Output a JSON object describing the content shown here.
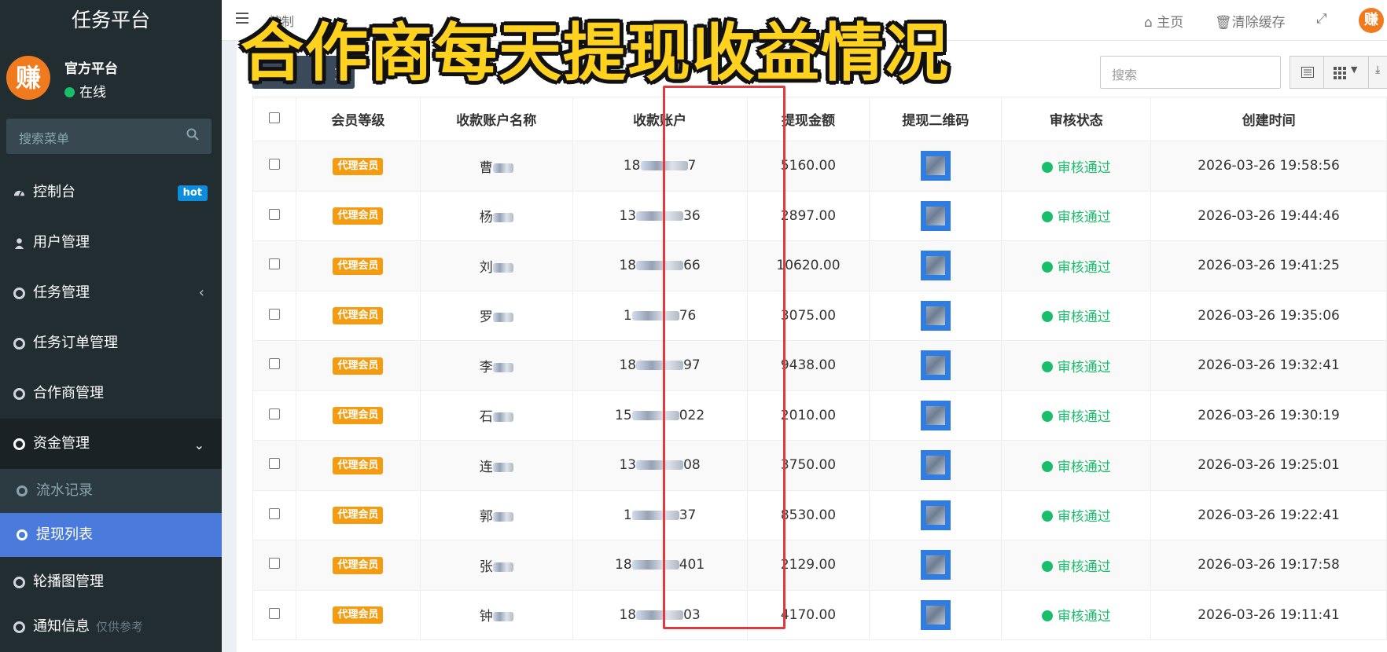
{
  "overlay": {
    "title": "合作商每天提现收益情况"
  },
  "sidebar": {
    "brand": "任务平台",
    "avatar_text": "赚",
    "user_name": "官方平台",
    "user_status": "在线",
    "search_placeholder": "搜索菜单",
    "items": [
      {
        "label": "控制台",
        "badge": "hot"
      },
      {
        "label": "用户管理"
      },
      {
        "label": "任务管理"
      },
      {
        "label": "任务订单管理"
      },
      {
        "label": "合作商管理"
      },
      {
        "label": "资金管理"
      },
      {
        "label": "轮播图管理"
      },
      {
        "label": "通知信息",
        "hint": "仅供参考"
      }
    ],
    "submenu": [
      {
        "label": "流水记录"
      },
      {
        "label": "提现列表"
      }
    ]
  },
  "topbar": {
    "tab": "控制",
    "home": "主页",
    "clear_cache": "清除缓存",
    "avatar_text": "赚"
  },
  "toolbar": {
    "button_partial": "更",
    "search_placeholder": "搜索"
  },
  "table": {
    "headers": [
      "会员等级",
      "收款账户名称",
      "收款账户",
      "提现金额",
      "提现二维码",
      "审核状态",
      "创建时间"
    ],
    "rows": [
      {
        "level": "代理会员",
        "name": "曹",
        "name_tail": "q",
        "account_head": "18",
        "account_tail": "7",
        "amount": "5160.00",
        "status": "审核通过",
        "time": "2026-03-26 19:58:56"
      },
      {
        "level": "代理会员",
        "name": "杨",
        "name_tail": "",
        "account_head": "13",
        "account_tail": "36",
        "amount": "2897.00",
        "status": "审核通过",
        "time": "2026-03-26 19:44:46"
      },
      {
        "level": "代理会员",
        "name": "刘",
        "name_tail": "",
        "account_head": "18",
        "account_tail": "66",
        "amount": "10620.00",
        "status": "审核通过",
        "time": "2026-03-26 19:41:25"
      },
      {
        "level": "代理会员",
        "name": "罗",
        "name_tail": "",
        "account_head": "1",
        "account_tail": "76",
        "amount": "3075.00",
        "status": "审核通过",
        "time": "2026-03-26 19:35:06"
      },
      {
        "level": "代理会员",
        "name": "李",
        "name_tail": "",
        "account_head": "18",
        "account_tail": "97",
        "amount": "9438.00",
        "status": "审核通过",
        "time": "2026-03-26 19:32:41"
      },
      {
        "level": "代理会员",
        "name": "石",
        "name_tail": "",
        "account_head": "15",
        "account_tail": "022",
        "amount": "2010.00",
        "status": "审核通过",
        "time": "2026-03-26 19:30:19"
      },
      {
        "level": "代理会员",
        "name": "连",
        "name_tail": "",
        "account_head": "13",
        "account_tail": "08",
        "amount": "3750.00",
        "status": "审核通过",
        "time": "2026-03-26 19:25:01"
      },
      {
        "level": "代理会员",
        "name": "郭",
        "name_tail": "",
        "account_head": "1",
        "account_tail": "37",
        "amount": "8530.00",
        "status": "审核通过",
        "time": "2026-03-26 19:22:41"
      },
      {
        "level": "代理会员",
        "name": "张",
        "name_tail": "",
        "account_head": "18",
        "account_tail": "401",
        "amount": "2129.00",
        "status": "审核通过",
        "time": "2026-03-26 19:17:58"
      },
      {
        "level": "代理会员",
        "name": "钟",
        "name_tail": "",
        "account_head": "18",
        "account_tail": "03",
        "amount": "4170.00",
        "status": "审核通过",
        "time": "2026-03-26 19:11:41"
      }
    ]
  },
  "colors": {
    "sidebar_bg": "#222d32",
    "active_menu": "#4a7bdc",
    "level_badge": "#f39c12",
    "status_green": "#19be6b",
    "highlight_red": "#e0393e",
    "overlay_yellow": "#ffd21f"
  }
}
